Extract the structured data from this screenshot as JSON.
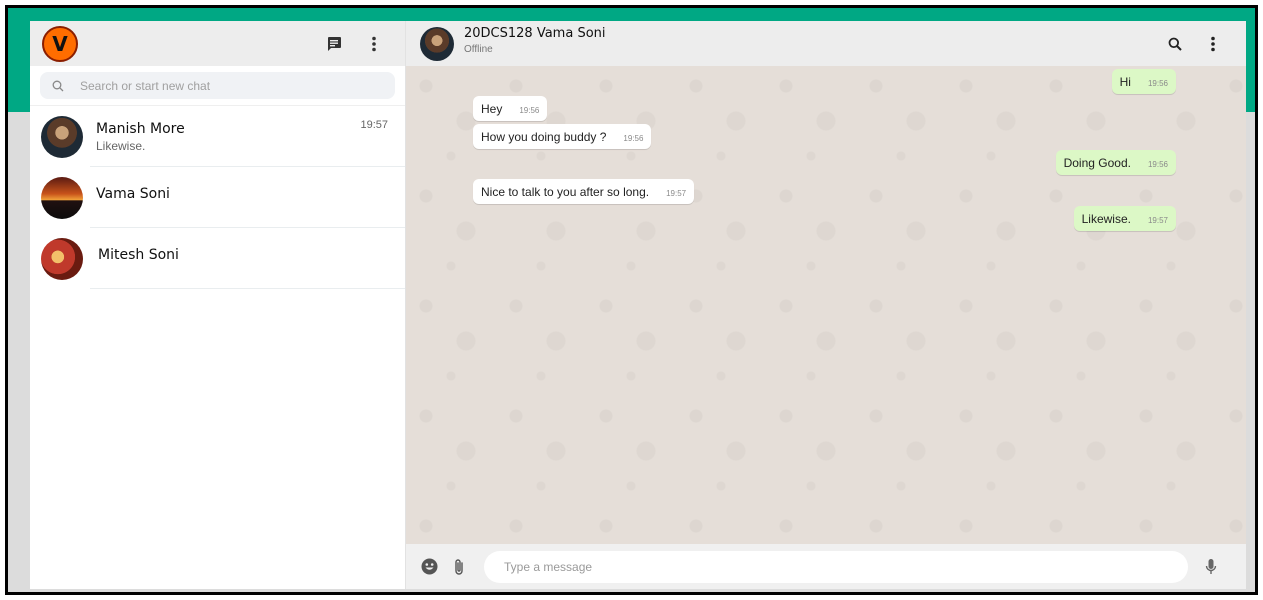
{
  "user": {
    "initial": "V"
  },
  "search": {
    "placeholder": "Search or start new chat"
  },
  "chats": [
    {
      "name": "Manish More",
      "last_message": "Likewise.",
      "time": "19:57"
    },
    {
      "name": "Vama Soni",
      "last_message": "",
      "time": ""
    },
    {
      "name": "Mitesh Soni",
      "last_message": "",
      "time": ""
    }
  ],
  "conversation": {
    "name": "20DCS128 Vama Soni",
    "status": "Offline",
    "messages": [
      {
        "direction": "out",
        "text": "Hi",
        "time": "19:56"
      },
      {
        "direction": "in",
        "text": "Hey",
        "time": "19:56"
      },
      {
        "direction": "in",
        "text": "How you doing buddy ?",
        "time": "19:56"
      },
      {
        "direction": "out",
        "text": "Doing Good.",
        "time": "19:56"
      },
      {
        "direction": "in",
        "text": "Nice to talk to you after so long.",
        "time": "19:57"
      },
      {
        "direction": "out",
        "text": "Likewise.",
        "time": "19:57"
      }
    ]
  },
  "composer": {
    "placeholder": "Type a message"
  },
  "colors": {
    "accent": "#00a884",
    "outgoing_bubble": "#dcf8c6",
    "incoming_bubble": "#ffffff",
    "chat_background": "#e5ded8"
  }
}
